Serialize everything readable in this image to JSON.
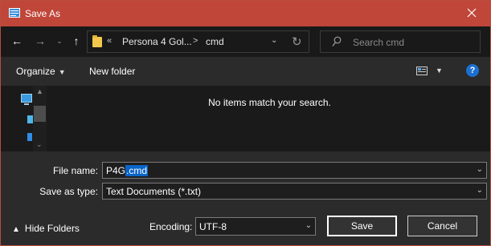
{
  "window": {
    "title": "Save As",
    "accent": "#c0463a"
  },
  "navbar": {
    "breadcrumb_prefix": "«",
    "crumbs": [
      "Persona 4 Gol...",
      "cmd"
    ],
    "separator": ">",
    "search_placeholder": "Search cmd"
  },
  "toolbar": {
    "organize_label": "Organize",
    "new_folder_label": "New folder",
    "help_label": "?"
  },
  "content": {
    "empty_message": "No items match your search."
  },
  "form": {
    "file_name_label": "File name:",
    "file_name_unselected": "P4G",
    "file_name_selected": ".cmd",
    "save_type_label": "Save as type:",
    "save_type_value": "Text Documents (*.txt)",
    "encoding_label": "Encoding:",
    "encoding_value": "UTF-8"
  },
  "footer": {
    "hide_folders_label": "Hide Folders",
    "save_label": "Save",
    "cancel_label": "Cancel"
  },
  "icons": [
    "notepad-icon",
    "back-icon",
    "forward-icon",
    "recent-dropdown-icon",
    "up-icon",
    "folder-icon",
    "refresh-icon",
    "search-icon",
    "view-icon",
    "help-icon",
    "this-pc-icon",
    "network-icon",
    "drive-icon"
  ]
}
